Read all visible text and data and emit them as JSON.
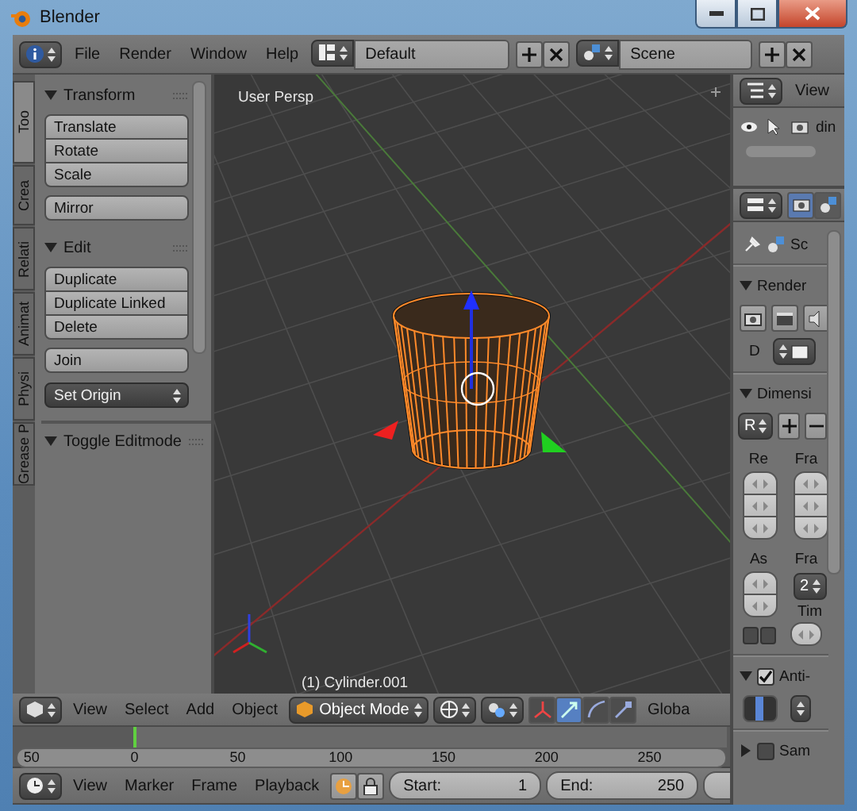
{
  "window": {
    "title": "Blender"
  },
  "info_header": {
    "menus": [
      "File",
      "Render",
      "Window",
      "Help"
    ],
    "layout": "Default",
    "scene": "Scene"
  },
  "tool_shelf": {
    "tabs": [
      {
        "label": "Too",
        "selected": true
      },
      {
        "label": "Crea",
        "selected": false
      },
      {
        "label": "Relati",
        "selected": false
      },
      {
        "label": "Animat",
        "selected": false
      },
      {
        "label": "Physi",
        "selected": false
      },
      {
        "label": "Grease P",
        "selected": false
      }
    ],
    "panels": [
      {
        "title": "Transform",
        "expanded": true,
        "groups": [
          [
            {
              "kind": "button",
              "label": "Translate"
            },
            {
              "kind": "button",
              "label": "Rotate"
            },
            {
              "kind": "button",
              "label": "Scale"
            }
          ],
          [
            {
              "kind": "button",
              "label": "Mirror"
            }
          ]
        ]
      },
      {
        "title": "Edit",
        "expanded": true,
        "groups": [
          [
            {
              "kind": "button",
              "label": "Duplicate"
            },
            {
              "kind": "button",
              "label": "Duplicate Linked"
            },
            {
              "kind": "button",
              "label": "Delete"
            }
          ],
          [
            {
              "kind": "button",
              "label": "Join"
            }
          ],
          [
            {
              "kind": "dropdown",
              "label": "Set Origin"
            }
          ]
        ]
      }
    ],
    "operator_panel": {
      "title": "Toggle Editmode",
      "expanded": true
    }
  },
  "viewport": {
    "view_name": "User Persp",
    "object_label": "(1) Cylinder.001"
  },
  "viewport_header": {
    "menus": [
      "View",
      "Select",
      "Add",
      "Object"
    ],
    "mode": "Object Mode",
    "manipulators": [
      {
        "kind": "toggle",
        "selected": false
      },
      {
        "kind": "translate",
        "selected": true
      },
      {
        "kind": "rotate",
        "selected": false
      },
      {
        "kind": "scale",
        "selected": false
      }
    ],
    "orientation": "Globa"
  },
  "timeline": {
    "ticks": [
      "50",
      "0",
      "50",
      "100",
      "150",
      "200",
      "250"
    ],
    "playhead": {
      "level": 0.168
    }
  },
  "timeline_header": {
    "menus": [
      "View",
      "Marker",
      "Frame",
      "Playback"
    ],
    "start": {
      "label": "Start:",
      "value": "1"
    },
    "end": {
      "label": "End:",
      "value": "250"
    }
  },
  "outliner": {
    "menu": "View",
    "row_text": "din"
  },
  "properties": {
    "tabs": [
      {
        "kind": "render",
        "selected": true
      },
      {
        "kind": "scene",
        "selected": false
      }
    ],
    "context": "Sc",
    "render": {
      "title": "Render",
      "expanded": true,
      "display_label": "D"
    },
    "dimensions": {
      "title": "Dimensi",
      "expanded": true,
      "preset": "R",
      "resolution_label": "Re",
      "frame_range_label": "Fra",
      "aspect_label": "As",
      "frame_rate_label": "Fra",
      "frame_rate": "2",
      "time_label": "Tim"
    },
    "anti_aliasing": {
      "title": "Anti-",
      "expanded": true,
      "checked": true
    },
    "sampled_motion": {
      "title": "Sam",
      "expanded": false,
      "checked": false
    }
  }
}
